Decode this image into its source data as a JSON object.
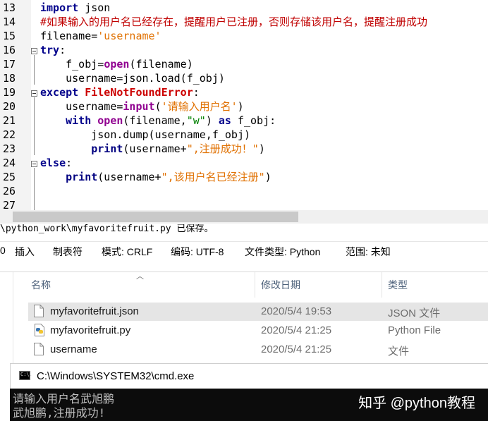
{
  "editor": {
    "lines": [
      {
        "num": "13",
        "tokens": [
          {
            "t": "import",
            "c": "kw"
          },
          {
            "t": " json",
            "c": ""
          }
        ]
      },
      {
        "num": "14",
        "tokens": [
          {
            "t": "#如果输入的用户名已经存在，提醒用户已注册，否则存储该用户名，提醒注册成功",
            "c": "cmt"
          }
        ]
      },
      {
        "num": "15",
        "tokens": [
          {
            "t": "filename=",
            "c": ""
          },
          {
            "t": "'username'",
            "c": "str2"
          }
        ]
      },
      {
        "num": "16",
        "tokens": [
          {
            "t": "try",
            "c": "kw"
          },
          {
            "t": ":",
            "c": ""
          }
        ]
      },
      {
        "num": "17",
        "tokens": [
          {
            "t": "    f_obj=",
            "c": ""
          },
          {
            "t": "open",
            "c": "fn"
          },
          {
            "t": "(filename)",
            "c": ""
          }
        ]
      },
      {
        "num": "18",
        "tokens": [
          {
            "t": "    username=json.load(f_obj)",
            "c": ""
          }
        ]
      },
      {
        "num": "19",
        "tokens": [
          {
            "t": "except",
            "c": "kw"
          },
          {
            "t": " ",
            "c": ""
          },
          {
            "t": "FileNotFoundError",
            "c": "exc"
          },
          {
            "t": ":",
            "c": ""
          }
        ]
      },
      {
        "num": "20",
        "tokens": [
          {
            "t": "    username=",
            "c": ""
          },
          {
            "t": "input",
            "c": "fn"
          },
          {
            "t": "(",
            "c": ""
          },
          {
            "t": "'请输入用户名'",
            "c": "str2"
          },
          {
            "t": ")",
            "c": ""
          }
        ]
      },
      {
        "num": "21",
        "tokens": [
          {
            "t": "    ",
            "c": ""
          },
          {
            "t": "with",
            "c": "kw"
          },
          {
            "t": " ",
            "c": ""
          },
          {
            "t": "open",
            "c": "fn"
          },
          {
            "t": "(filename,",
            "c": ""
          },
          {
            "t": "\"w\"",
            "c": "str"
          },
          {
            "t": ") ",
            "c": ""
          },
          {
            "t": "as",
            "c": "kw"
          },
          {
            "t": " f_obj:",
            "c": ""
          }
        ]
      },
      {
        "num": "22",
        "tokens": [
          {
            "t": "        json.dump(username,f_obj)",
            "c": ""
          }
        ]
      },
      {
        "num": "23",
        "tokens": [
          {
            "t": "        ",
            "c": ""
          },
          {
            "t": "print",
            "c": "kw2"
          },
          {
            "t": "(username+",
            "c": ""
          },
          {
            "t": "\",注册成功！\"",
            "c": "str2"
          },
          {
            "t": ")",
            "c": ""
          }
        ]
      },
      {
        "num": "24",
        "tokens": [
          {
            "t": "else",
            "c": "kw"
          },
          {
            "t": ":",
            "c": ""
          }
        ]
      },
      {
        "num": "25",
        "tokens": [
          {
            "t": "    ",
            "c": ""
          },
          {
            "t": "print",
            "c": "kw2"
          },
          {
            "t": "(username+",
            "c": ""
          },
          {
            "t": "\",该用户名已经注册\"",
            "c": "str2"
          },
          {
            "t": ")",
            "c": ""
          }
        ]
      },
      {
        "num": "26",
        "tokens": []
      },
      {
        "num": "27",
        "tokens": []
      }
    ]
  },
  "message": "\\python_work\\myfavoritefruit.py 已保存。",
  "statusbar": {
    "left_char": "0",
    "insert": "插入",
    "tab": "制表符",
    "mode": "模式: CRLF",
    "encoding": "编码: UTF-8",
    "filetype": "文件类型: Python",
    "scope": "范围: 未知"
  },
  "explorer": {
    "headers": {
      "name": "名称",
      "date": "修改日期",
      "type": "类型"
    },
    "files": [
      {
        "name": "myfavoritefruit.json",
        "date": "2020/5/4 19:53",
        "type": "JSON 文件",
        "icon": "file-icon",
        "selected": true
      },
      {
        "name": "myfavoritefruit.py",
        "date": "2020/5/4 21:25",
        "type": "Python File",
        "icon": "python-file-icon",
        "selected": false
      },
      {
        "name": "username",
        "date": "2020/5/4 21:25",
        "type": "文件",
        "icon": "file-icon",
        "selected": false
      }
    ]
  },
  "cmd": {
    "title": "C:\\Windows\\SYSTEM32\\cmd.exe",
    "icon_text": "C:\\.",
    "lines": [
      "请输入用户名武旭鹏",
      "武旭鹏,注册成功!"
    ],
    "watermark": "知乎 @python教程"
  }
}
